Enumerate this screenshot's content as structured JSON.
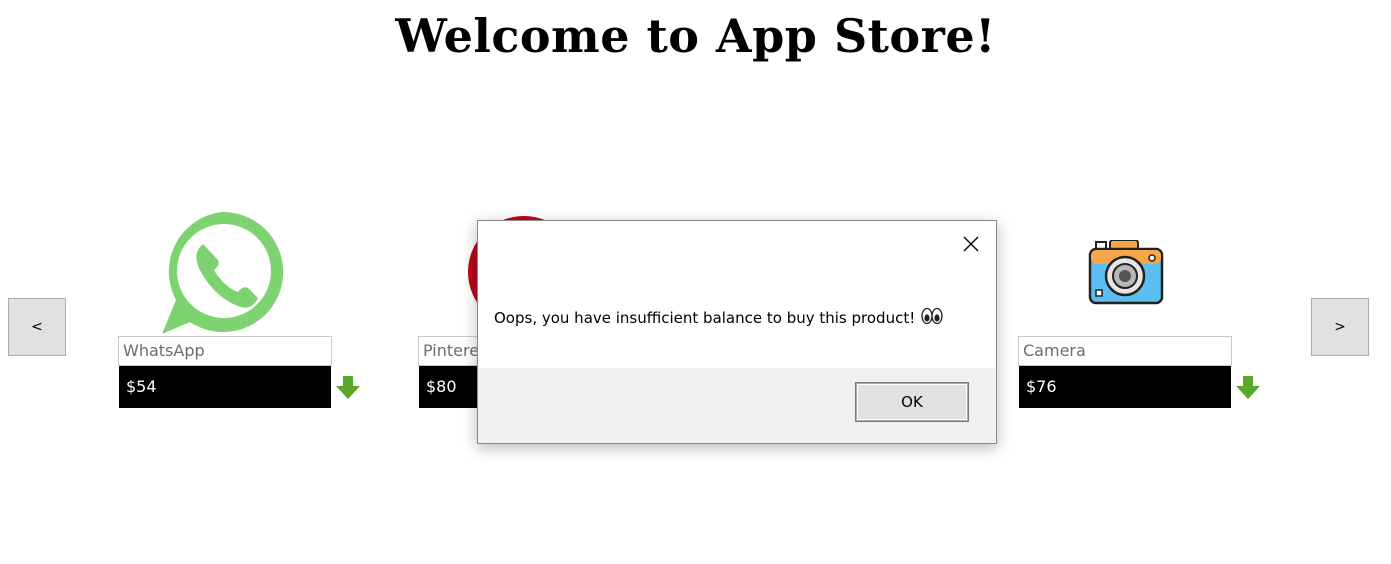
{
  "header": {
    "title": "Welcome to App Store!"
  },
  "nav": {
    "prev_label": "<",
    "next_label": ">"
  },
  "apps": [
    {
      "name": "WhatsApp",
      "price": "$54",
      "icon": "whatsapp-icon"
    },
    {
      "name": "Pintere",
      "price": "$80",
      "icon": "pinterest-icon"
    },
    {
      "name": "Camera",
      "price": "$76",
      "icon": "camera-icon"
    }
  ],
  "dialog": {
    "message": "Oops, you have insufficient balance to buy this product!",
    "emoji_icon": "eyes-icon",
    "ok_label": "OK"
  },
  "colors": {
    "whatsapp_green": "#7dd36f",
    "pinterest_red": "#b7081b",
    "download_green": "#5aa82a",
    "price_bar": "#000000"
  }
}
